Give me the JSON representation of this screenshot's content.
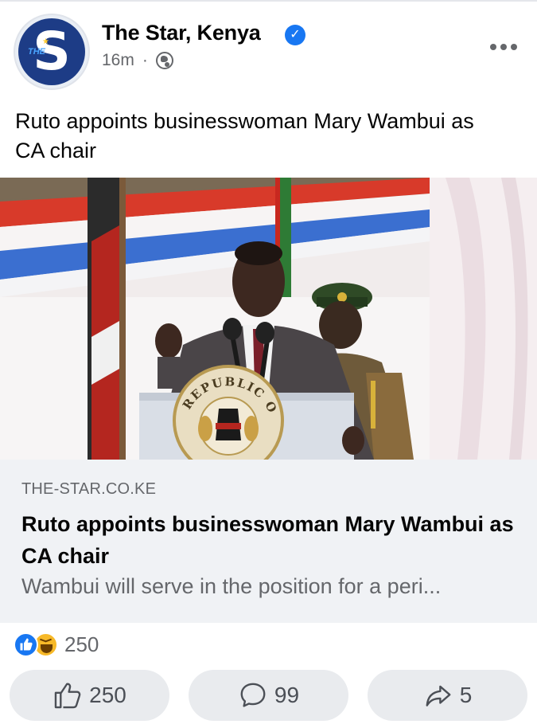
{
  "post": {
    "page_name": "The Star, Kenya",
    "time": "16m",
    "separator": "·",
    "caption": "Ruto appoints businesswoman Mary Wambui as CA chair",
    "avatar_letter": "S",
    "avatar_small_text": "THE"
  },
  "photo": {
    "podium_seal_text": "REPUBLIC OF"
  },
  "link_preview": {
    "domain": "THE-STAR.CO.KE",
    "title": "Ruto appoints businesswoman Mary Wambui as CA chair",
    "description": "Wambui will serve in the position for a peri..."
  },
  "reactions": {
    "types": [
      "like-icon",
      "haha-icon"
    ],
    "count": "250"
  },
  "actions": {
    "like_count": "250",
    "comment_count": "99",
    "share_count": "5"
  },
  "colors": {
    "accent": "#1877f2",
    "secondary_text": "#65676b",
    "link_box_bg": "#f0f2f5",
    "button_bg": "#e9ebee",
    "avatar_bg": "#1d3c86"
  }
}
